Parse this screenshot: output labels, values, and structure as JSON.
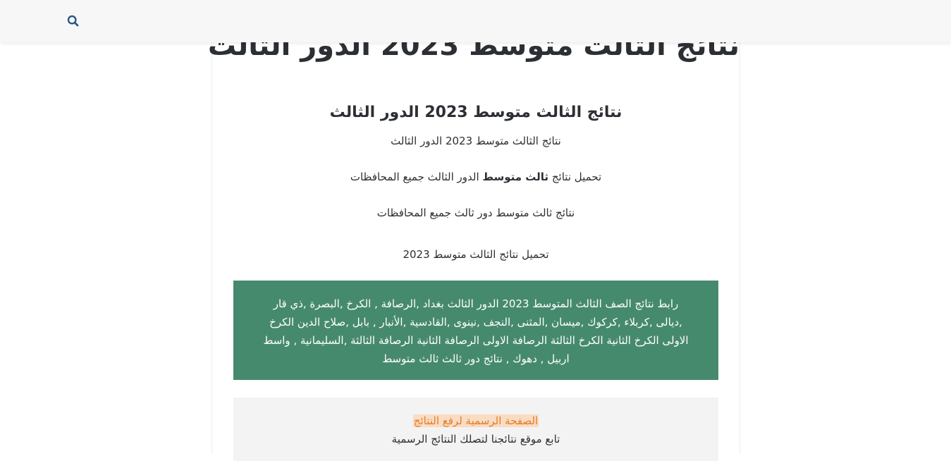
{
  "header": {
    "search_icon": "search-icon"
  },
  "article": {
    "title": "نتائج الثالث متوسط 2023 الدور الثالث",
    "heading": "نتائج الثالث متوسط 2023 الدور الثالث",
    "para1": "نتائج الثالث متوسط 2023 الدور الثالث",
    "para2_start": "تحميل نتائج",
    "para2_bold": "ثالث متوسط",
    "para2_end": "الدور الثالث جميع المحافظات",
    "para3": "نتائج ثالث متوسط دور ثالث جميع المحافظات",
    "para4": "تحميل نتائج الثالث متوسط 2023"
  },
  "green_box": {
    "text": "رابط نتائج الصف الثالث المتوسط 2023 الدور الثالث بغداد ,الرصافة , الكرخ ,البصرة ,ذي قار ,ديالى ,كربلاء ,كركوك ,ميسان ,المثنى ,النجف ,نينوى ,القادسية ,الأنبار , بابل ,صلاح الدين الكرخ الاولى الكرخ الثانية الكرخ الثالثة الرصافة الاولى الرصافة الثانية الرصافة الثالثة ,السليمانية , واسط اربيل , دهوك , نتائج دور ثالث ثالث متوسط"
  },
  "notice": {
    "link_text": "الصفحة الرسمية لرفع النتائج",
    "subtext": "تابع موقع نتائجنا لتصلك النتائج الرسمية"
  },
  "colors": {
    "green_box_bg": "#468a6e",
    "link_color": "#e67e22",
    "link_highlight": "#f9dcc4",
    "search_icon": "#2a5a8c"
  }
}
